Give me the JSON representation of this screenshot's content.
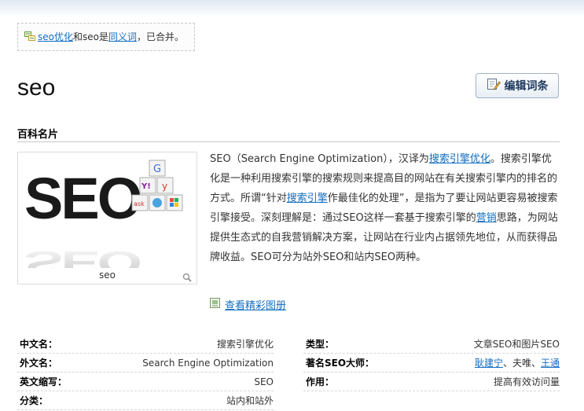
{
  "notice": {
    "link1": "seo优化",
    "mid": "和seo是",
    "link2": "同义词",
    "tail": "，已合并。"
  },
  "title": "seo",
  "edit_button": "编辑词条",
  "section_title": "百科名片",
  "picture": {
    "caption": "seo",
    "big_text": "SEO",
    "cube_letters": [
      "G",
      "Y!",
      "y",
      "ask",
      "ie",
      "win"
    ]
  },
  "summary": [
    {
      "t": "SEO（Search Engine Optimization），汉译为"
    },
    {
      "t": "搜索引擎优化",
      "link": true
    },
    {
      "t": "。搜索引擎优化是一种利用搜索引擎的搜索规则来提高目的网站在有关搜索引擎内的排名的方式。所谓“针对"
    },
    {
      "t": "搜索引擎",
      "link": true
    },
    {
      "t": "作最佳化的处理”，是指为了要让网站更容易被搜索引擎接受。深刻理解是：通过SEO这样一套基于搜索引擎的"
    },
    {
      "t": "营销",
      "link": true
    },
    {
      "t": "思路，为网站提供生态式的自我营销解决方案，让网站在行业内占据领先地位，从而获得品牌收益。SEO可分为站外SEO和站内SEO两种。"
    }
  ],
  "gallery_link": "查看精彩图册",
  "info": {
    "left": [
      {
        "k": "中文名：",
        "v": "搜索引擎优化"
      },
      {
        "k": "外文名：",
        "v": "Search Engine Optimization"
      },
      {
        "k": "英文缩写：",
        "v": "SEO"
      },
      {
        "k": "分类：",
        "v": "站内和站外"
      }
    ],
    "right": [
      {
        "k": "类型：",
        "v": "文章SEO和图片SEO"
      },
      {
        "k": "著名SEO大师：",
        "v_parts": [
          {
            "t": "耿建宁",
            "link": true
          },
          {
            "t": "、夫唯、"
          },
          {
            "t": "王通",
            "link": true
          }
        ]
      },
      {
        "k": "作用：",
        "v": "提高有效访问量"
      }
    ]
  }
}
